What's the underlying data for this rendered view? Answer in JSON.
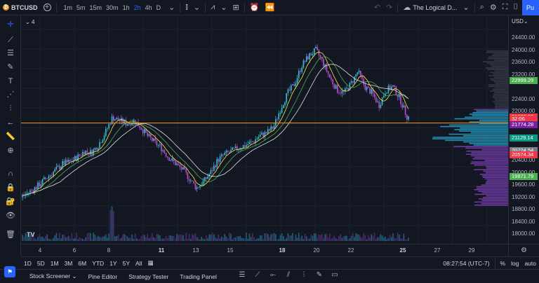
{
  "toolbar": {
    "symbol": "BTCUSD",
    "symbol_glyph": "₿",
    "add_label": "+",
    "timeframes": [
      "1m",
      "5m",
      "15m",
      "30m",
      "1h",
      "2h",
      "4h",
      "D"
    ],
    "active_timeframe": "2h",
    "layout_name": "The Logical D...",
    "publish_label": "Pu"
  },
  "legend": {
    "collapsed_count": "4"
  },
  "price_axis": {
    "currency": "USD",
    "ticks": [
      {
        "label": "24400.00",
        "price": 24400
      },
      {
        "label": "24000.00",
        "price": 24000
      },
      {
        "label": "23600.00",
        "price": 23600
      },
      {
        "label": "23200.00",
        "price": 23200
      },
      {
        "label": "22400.00",
        "price": 22400
      },
      {
        "label": "22000.00",
        "price": 22000
      },
      {
        "label": "20400.00",
        "price": 20400
      },
      {
        "label": "20000.00",
        "price": 20000
      },
      {
        "label": "19600.00",
        "price": 19600
      },
      {
        "label": "19200.00",
        "price": 19200
      },
      {
        "label": "18800.00",
        "price": 18800
      },
      {
        "label": "18400.00",
        "price": 18400
      },
      {
        "label": "18000.00",
        "price": 18000
      }
    ],
    "badges": [
      {
        "label": "22999.29",
        "price": 22999.29,
        "color": "#4caf50"
      },
      {
        "label": "21822.58",
        "price": 21822.58,
        "color": "#f23645"
      },
      {
        "label": "32:06",
        "price": 21740,
        "color": "#f23645"
      },
      {
        "label": "21774.28",
        "price": 21560,
        "color": "#7b1fa2"
      },
      {
        "label": "21129.14",
        "price": 21129.14,
        "color": "#089981"
      },
      {
        "label": "20724.54",
        "price": 20724.54,
        "color": "#787b86"
      },
      {
        "label": "20574.34",
        "price": 20574.34,
        "color": "#f23645"
      },
      {
        "label": "19871.79",
        "price": 19871.79,
        "color": "#4caf50"
      }
    ]
  },
  "time_axis": {
    "ticks": [
      {
        "label": "4",
        "x": 27,
        "bold": false
      },
      {
        "label": "6",
        "x": 76,
        "bold": false
      },
      {
        "label": "8",
        "x": 125,
        "bold": false
      },
      {
        "label": "11",
        "x": 200,
        "bold": true
      },
      {
        "label": "13",
        "x": 249,
        "bold": false
      },
      {
        "label": "15",
        "x": 298,
        "bold": false
      },
      {
        "label": "18",
        "x": 372,
        "bold": true
      },
      {
        "label": "20",
        "x": 421,
        "bold": false
      },
      {
        "label": "22",
        "x": 470,
        "bold": false
      },
      {
        "label": "25",
        "x": 544,
        "bold": true
      },
      {
        "label": "27",
        "x": 593,
        "bold": false
      },
      {
        "label": "29",
        "x": 642,
        "bold": false
      }
    ]
  },
  "range_bar": {
    "ranges": [
      "1D",
      "5D",
      "1M",
      "3M",
      "6M",
      "YTD",
      "1Y",
      "5Y",
      "All"
    ],
    "clock": "08:27:54 (UTC-7)",
    "percent": "%",
    "log": "log",
    "auto": "auto"
  },
  "bottom_tabs": [
    "Stock Screener",
    "Pine Editor",
    "Strategy Tester",
    "Trading Panel"
  ],
  "chart_data": {
    "type": "candlestick",
    "symbol": "BTCUSD",
    "interval": "2h",
    "horizontal_line_price": 21620,
    "ylim": [
      17800,
      24700
    ],
    "close_path": [
      [
        0,
        19200
      ],
      [
        10,
        19350
      ],
      [
        20,
        19500
      ],
      [
        30,
        19700
      ],
      [
        40,
        19900
      ],
      [
        50,
        20100
      ],
      [
        60,
        20300
      ],
      [
        70,
        20350
      ],
      [
        80,
        20500
      ],
      [
        90,
        20700
      ],
      [
        100,
        20650
      ],
      [
        110,
        20900
      ],
      [
        120,
        21300
      ],
      [
        130,
        21800
      ],
      [
        140,
        21700
      ],
      [
        150,
        21600
      ],
      [
        160,
        21700
      ],
      [
        170,
        21500
      ],
      [
        180,
        21200
      ],
      [
        190,
        21000
      ],
      [
        200,
        20800
      ],
      [
        210,
        20500
      ],
      [
        220,
        20300
      ],
      [
        230,
        20100
      ],
      [
        240,
        19800
      ],
      [
        250,
        19500
      ],
      [
        260,
        19700
      ],
      [
        270,
        20000
      ],
      [
        280,
        20400
      ],
      [
        290,
        20600
      ],
      [
        300,
        20700
      ],
      [
        310,
        20800
      ],
      [
        320,
        20900
      ],
      [
        330,
        21000
      ],
      [
        340,
        21200
      ],
      [
        350,
        21300
      ],
      [
        360,
        21500
      ],
      [
        370,
        22100
      ],
      [
        380,
        22600
      ],
      [
        390,
        22900
      ],
      [
        400,
        23500
      ],
      [
        410,
        23800
      ],
      [
        420,
        24000
      ],
      [
        430,
        23600
      ],
      [
        440,
        23100
      ],
      [
        450,
        22700
      ],
      [
        460,
        22600
      ],
      [
        470,
        22900
      ],
      [
        480,
        23300
      ],
      [
        490,
        22800
      ],
      [
        500,
        22600
      ],
      [
        510,
        22200
      ],
      [
        520,
        22700
      ],
      [
        530,
        22800
      ],
      [
        540,
        22400
      ],
      [
        550,
        21822.58
      ]
    ]
  }
}
